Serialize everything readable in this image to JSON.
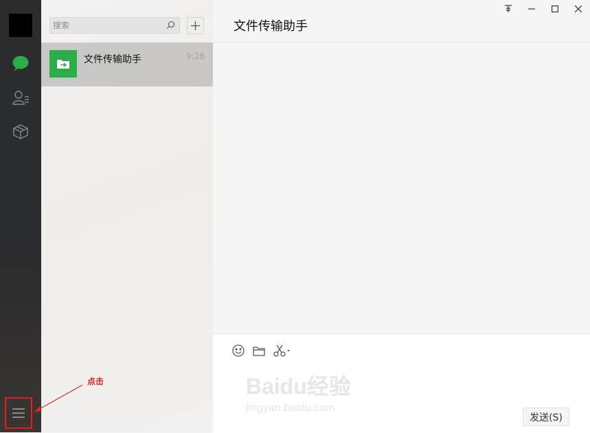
{
  "sidebar": {
    "nav": [
      {
        "name": "chat-icon",
        "active": true
      },
      {
        "name": "contacts-icon",
        "active": false
      },
      {
        "name": "box-icon",
        "active": false
      }
    ],
    "menu_icon": "hamburger-icon"
  },
  "chatlist": {
    "search_placeholder": "搜索",
    "add_icon": "plus-icon",
    "items": [
      {
        "name": "文件传输助手",
        "time": "9:28",
        "icon": "folder-arrow-icon"
      }
    ]
  },
  "main": {
    "title": "文件传输助手",
    "window_controls": [
      "pin-icon",
      "minimize-icon",
      "maximize-icon",
      "close-icon"
    ],
    "tools": [
      "emoji-icon",
      "folder-icon",
      "scissors-icon"
    ],
    "send_label": "发送(S)"
  },
  "annotation": {
    "label": "点击"
  },
  "watermark": {
    "line1": "Baidu经验",
    "line2": "jingyan.baidu.com"
  },
  "colors": {
    "accent_green": "#2bab49",
    "annotation_red": "#e0221e",
    "sidebar_bg": "#2b2c2e"
  }
}
